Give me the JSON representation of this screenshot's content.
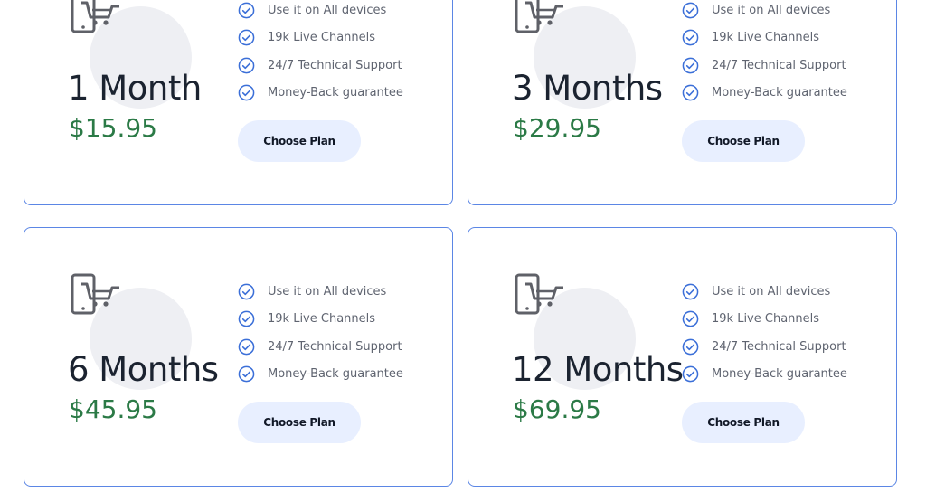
{
  "plans": [
    {
      "title": "1 Month",
      "price": "$15.95",
      "features": [
        "Use it on All devices",
        "19k Live Channels",
        "24/7 Technical Support",
        "Money-Back guarantee"
      ],
      "button_label": "Choose Plan"
    },
    {
      "title": "3 Months",
      "price": "$29.95",
      "features": [
        "Use it on All devices",
        "19k Live Channels",
        "24/7 Technical Support",
        "Money-Back guarantee"
      ],
      "button_label": "Choose Plan"
    },
    {
      "title": "6 Months",
      "price": "$45.95",
      "features": [
        "Use it on All devices",
        "19k Live Channels",
        "24/7 Technical Support",
        "Money-Back guarantee"
      ],
      "button_label": "Choose Plan"
    },
    {
      "title": "12 Months",
      "price": "$69.95",
      "features": [
        "Use it on All devices",
        "19k Live Channels",
        "24/7 Technical Support",
        "Money-Back guarantee"
      ],
      "button_label": "Choose Plan"
    }
  ],
  "icons": {
    "plan": "mobile-cart-icon",
    "feature": "check-circle-icon"
  },
  "colors": {
    "card_border": "#5b86e5",
    "price": "#2b7a46",
    "check": "#3b6fd8",
    "button_bg": "#e8efff"
  }
}
